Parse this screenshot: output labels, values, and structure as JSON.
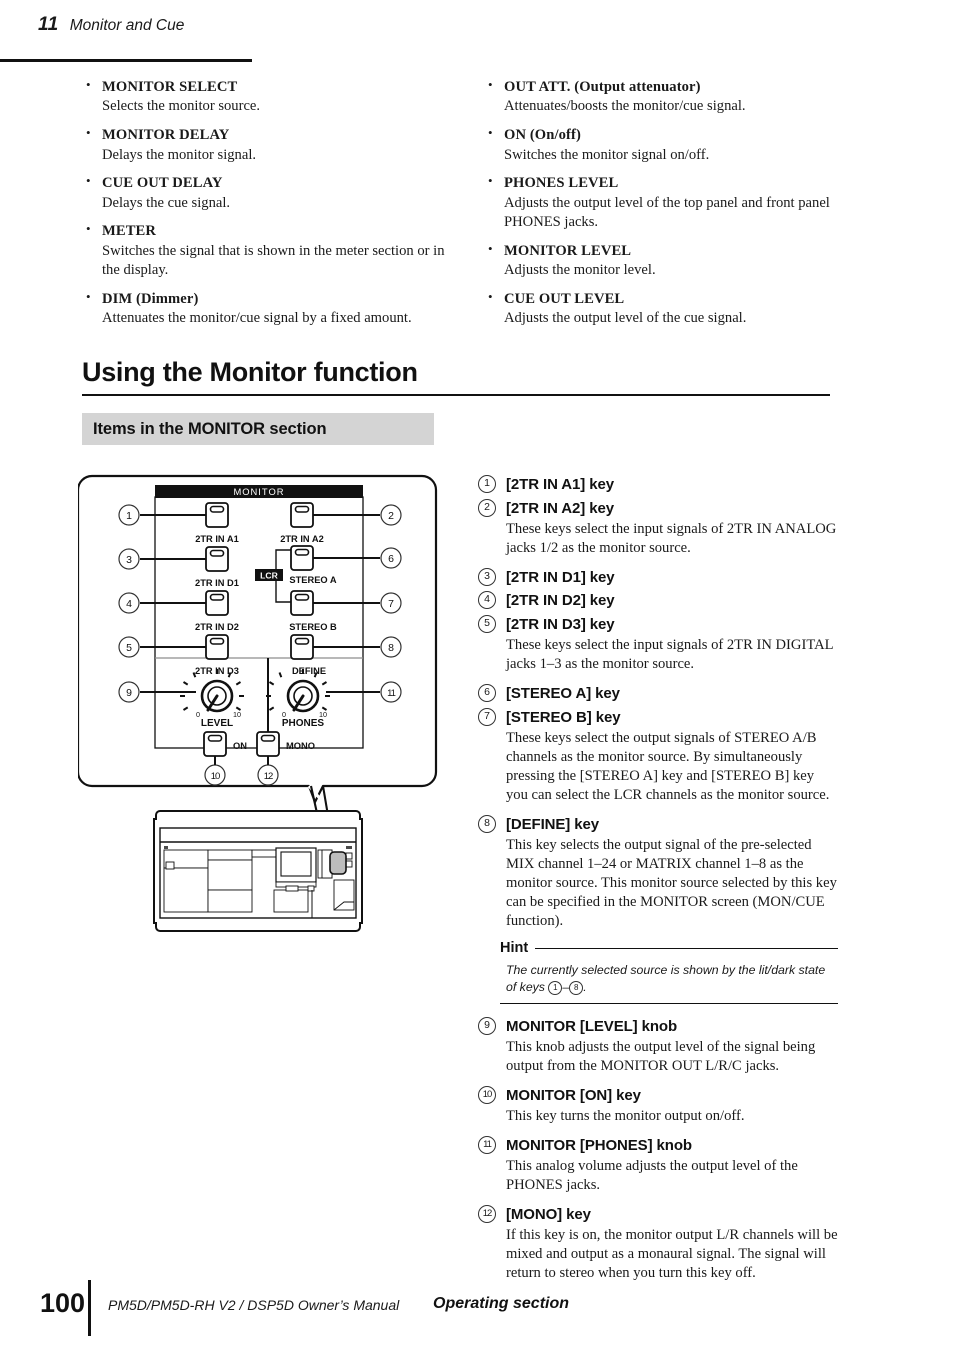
{
  "header": {
    "chapter_number": "11",
    "chapter_title": "Monitor and Cue"
  },
  "top_bullets": {
    "left": [
      {
        "term": "MONITOR SELECT",
        "desc": "Selects the monitor source."
      },
      {
        "term": "MONITOR DELAY",
        "desc": "Delays the monitor signal."
      },
      {
        "term": "CUE OUT DELAY",
        "desc": "Delays the cue signal."
      },
      {
        "term": "METER",
        "desc": "Switches the signal that is shown in the meter section or in the display."
      },
      {
        "term": "DIM (Dimmer)",
        "desc": "Attenuates the monitor/cue signal by a fixed amount."
      }
    ],
    "right": [
      {
        "term": "OUT ATT. (Output attenuator)",
        "desc": "Attenuates/boosts the monitor/cue signal."
      },
      {
        "term": "ON (On/off)",
        "desc": "Switches the monitor signal on/off."
      },
      {
        "term": "PHONES LEVEL",
        "desc": "Adjusts the output level of the top panel and front panel PHONES jacks."
      },
      {
        "term": "MONITOR LEVEL",
        "desc": "Adjusts the monitor level."
      },
      {
        "term": "CUE OUT LEVEL",
        "desc": "Adjusts the output level of the cue signal."
      }
    ]
  },
  "section_heading": "Using the Monitor function",
  "sub_heading": "Items in the MONITOR section",
  "diagram": {
    "panel_title": "MONITOR",
    "lcr_badge": "LCR",
    "buttons": [
      {
        "callout": "1",
        "label": "2TR IN A1"
      },
      {
        "callout": "2",
        "label": "2TR IN A2"
      },
      {
        "callout": "3",
        "label": "2TR IN D1"
      },
      {
        "callout": "4",
        "label": "2TR IN D2"
      },
      {
        "callout": "5",
        "label": "2TR IN D3"
      },
      {
        "callout": "6",
        "label": "STEREO A"
      },
      {
        "callout": "7",
        "label": "STEREO B"
      },
      {
        "callout": "8",
        "label": "DEFINE"
      },
      {
        "callout": "10",
        "label": "ON"
      },
      {
        "callout": "12",
        "label": "MONO"
      }
    ],
    "knobs": [
      {
        "callout": "9",
        "label": "LEVEL",
        "min_tick": "0",
        "max_tick": "10"
      },
      {
        "callout": "11",
        "label": "PHONES",
        "min_tick": "0",
        "max_tick": "10"
      }
    ]
  },
  "items": [
    {
      "num": "1",
      "title": "[2TR IN A1] key",
      "desc": ""
    },
    {
      "num": "2",
      "title": "[2TR IN A2] key",
      "desc": "These keys select the input signals of 2TR IN ANALOG jacks 1/2 as the monitor source."
    },
    {
      "num": "3",
      "title": "[2TR IN D1] key",
      "desc": ""
    },
    {
      "num": "4",
      "title": "[2TR IN D2] key",
      "desc": ""
    },
    {
      "num": "5",
      "title": "[2TR IN D3] key",
      "desc": "These keys select the input signals of 2TR IN DIGITAL jacks 1–3 as the monitor source."
    },
    {
      "num": "6",
      "title": "[STEREO A] key",
      "desc": ""
    },
    {
      "num": "7",
      "title": "[STEREO B] key",
      "desc": "These keys select the output signals of STEREO A/B channels as the monitor source. By simultaneously pressing the [STEREO A] key and [STEREO B] key you can select the LCR channels as the monitor source."
    },
    {
      "num": "8",
      "title": "[DEFINE] key",
      "desc": "This key selects the output signal of the pre-selected MIX channel 1–24 or MATRIX channel 1–8 as the monitor source. This monitor source selected by this key can be specified in the MONITOR screen (MON/CUE function)."
    },
    {
      "num": "9",
      "title": "MONITOR [LEVEL] knob",
      "desc": "This knob adjusts the output level of the signal being output from the MONITOR OUT L/R/C jacks."
    },
    {
      "num": "10",
      "title": "MONITOR [ON] key",
      "desc": "This key turns the monitor output on/off."
    },
    {
      "num": "11",
      "title": "MONITOR [PHONES] knob",
      "desc": "This analog volume adjusts the output level of the PHONES jacks."
    },
    {
      "num": "12",
      "title": "[MONO] key",
      "desc": "If this key is on, the monitor output L/R channels will be mixed and output as a monaural signal. The signal will return to stereo when you turn this key off."
    }
  ],
  "hint": {
    "label": "Hint",
    "text_before": "The currently selected source is shown by the lit/dark state of keys ",
    "key_first": "1",
    "key_dash": "–",
    "key_last": "8",
    "text_after": "."
  },
  "footer": {
    "page_number": "100",
    "manual_title": "PM5D/PM5D-RH V2 / DSP5D Owner’s Manual",
    "section_label": "Operating section"
  }
}
